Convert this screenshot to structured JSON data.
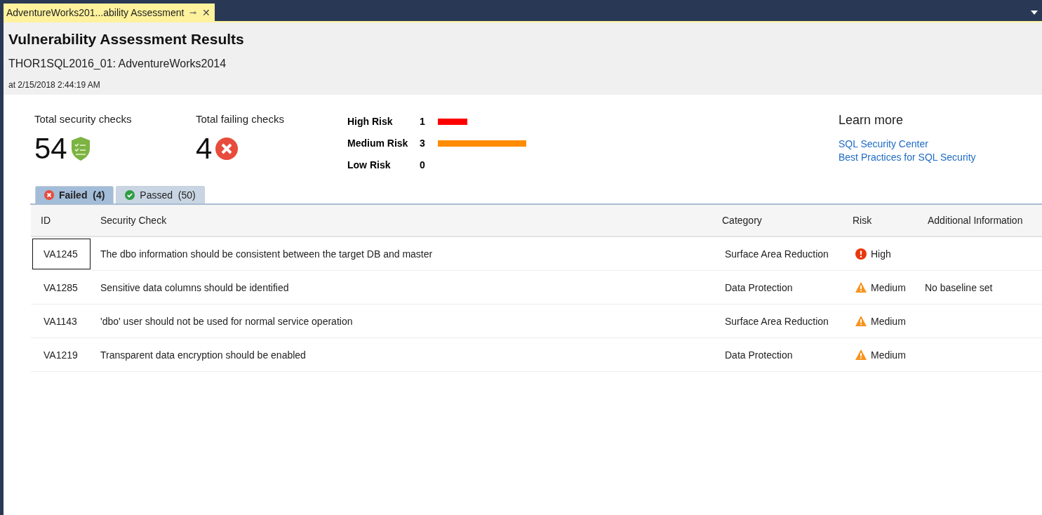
{
  "document_tab": {
    "title": "AdventureWorks201...ability Assessment",
    "pin": "⊸",
    "close": "✕"
  },
  "header": {
    "title": "Vulnerability Assessment Results",
    "database": "THOR1SQL2016_01: AdventureWorks2014",
    "timestamp": "at 2/15/2018 2:44:19 AM"
  },
  "summary": {
    "total_label": "Total security checks",
    "total_value": "54",
    "failing_label": "Total failing checks",
    "failing_value": "4"
  },
  "risk_levels": [
    {
      "label": "High Risk",
      "count": "1",
      "color": "#ff0000"
    },
    {
      "label": "Medium Risk",
      "count": "3",
      "color": "#ff8c00"
    },
    {
      "label": "Low Risk",
      "count": "0"
    }
  ],
  "learn_more": {
    "title": "Learn more",
    "links": [
      "SQL Security Center",
      "Best Practices for SQL Security"
    ]
  },
  "tabs": [
    {
      "kind": "failed",
      "label": "Failed",
      "count": "(4)",
      "selected": true
    },
    {
      "kind": "passed",
      "label": "Passed",
      "count": "(50)",
      "selected": false
    }
  ],
  "table": {
    "columns": [
      "ID",
      "Security Check",
      "Category",
      "Risk",
      "Additional Information"
    ],
    "rows": [
      {
        "id": "VA1245",
        "check": "The dbo information should be consistent between the target DB and master",
        "category": "Surface Area Reduction",
        "kind": "high",
        "risk": "High",
        "focused": true
      },
      {
        "id": "VA1285",
        "check": "Sensitive data columns should be identified",
        "category": "Data Protection",
        "kind": "medium",
        "risk": "Medium",
        "info": "No baseline set",
        "focused": false
      },
      {
        "id": "VA1143",
        "check": "'dbo' user should not be used for normal service operation",
        "category": "Surface Area Reduction",
        "kind": "medium",
        "risk": "Medium",
        "focused": false
      },
      {
        "id": "VA1219",
        "check": "Transparent data encryption should be enabled",
        "category": "Data Protection",
        "kind": "medium",
        "risk": "Medium",
        "focused": false
      }
    ]
  }
}
